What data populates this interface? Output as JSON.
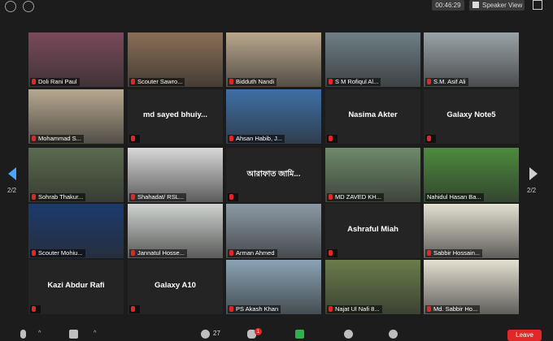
{
  "topbar": {
    "timer": "00:46:29",
    "speaker_view_label": "Speaker View"
  },
  "pagination": {
    "left": "2/2",
    "right": "2/2"
  },
  "participants": [
    {
      "name": "Doli Rani Paul",
      "video": true,
      "bg": "#7a4a5a",
      "muted": true
    },
    {
      "name": "Scouter Sawro...",
      "video": true,
      "bg": "#8a6e55",
      "muted": true
    },
    {
      "name": "Bidduth Nandi",
      "video": true,
      "bg": "#b9a78c",
      "muted": true
    },
    {
      "name": "S M Rofiqul Al...",
      "video": true,
      "bg": "#6f7f86",
      "muted": true
    },
    {
      "name": "S.M. Asif Ali",
      "video": true,
      "bg": "#9aa3a8",
      "muted": true
    },
    {
      "name": "Mohammad S...",
      "video": true,
      "bg": "#b7a98f",
      "muted": true
    },
    {
      "name": "md sayed bhuiy...",
      "video": false,
      "muted": true
    },
    {
      "name": "Ahsan Habib, J...",
      "video": true,
      "bg": "#3e6fa6",
      "muted": true
    },
    {
      "name": "Nasima Akter",
      "video": false,
      "muted": true
    },
    {
      "name": "Galaxy Note5",
      "video": false,
      "muted": true
    },
    {
      "name": "Sohrab Thakur...",
      "video": true,
      "bg": "#5a6b4e",
      "muted": true
    },
    {
      "name": "Shahadat/ RSL...",
      "video": true,
      "bg": "#d8d8d8",
      "muted": true
    },
    {
      "name": "আরাফাত জামি...",
      "video": false,
      "muted": true
    },
    {
      "name": "MD ZAVED KH...",
      "video": true,
      "bg": "#6f8a6a",
      "muted": true
    },
    {
      "name": "Nahidul Hasan Ba...",
      "video": true,
      "bg": "#4d8b3d",
      "muted": false
    },
    {
      "name": "Scouter Mohiu...",
      "video": true,
      "bg": "#1c3a6e",
      "muted": true
    },
    {
      "name": "Jannatul Hosse...",
      "video": true,
      "bg": "#cfd3d0",
      "muted": true
    },
    {
      "name": "Arman Ahmed",
      "video": true,
      "bg": "#8c9aa5",
      "muted": true
    },
    {
      "name": "Ashraful Miah",
      "video": false,
      "muted": true
    },
    {
      "name": "Sabbir Hossain...",
      "video": true,
      "bg": "#e4e0d2",
      "muted": true
    },
    {
      "name": "Kazi Abdur Rafi",
      "video": false,
      "muted": true
    },
    {
      "name": "Galaxy A10",
      "video": false,
      "muted": true
    },
    {
      "name": "PS Akash Khan",
      "video": true,
      "bg": "#8aa3b5",
      "muted": true
    },
    {
      "name": "Najat Ul Nafi 8...",
      "video": true,
      "bg": "#6a7d4a",
      "muted": true
    },
    {
      "name": "Md. Sabbir Ho...",
      "video": true,
      "bg": "#e4e0d2",
      "muted": true
    }
  ],
  "toolbar": {
    "participants_count": "27",
    "chat_badge": "1",
    "leave_label": "Leave"
  }
}
